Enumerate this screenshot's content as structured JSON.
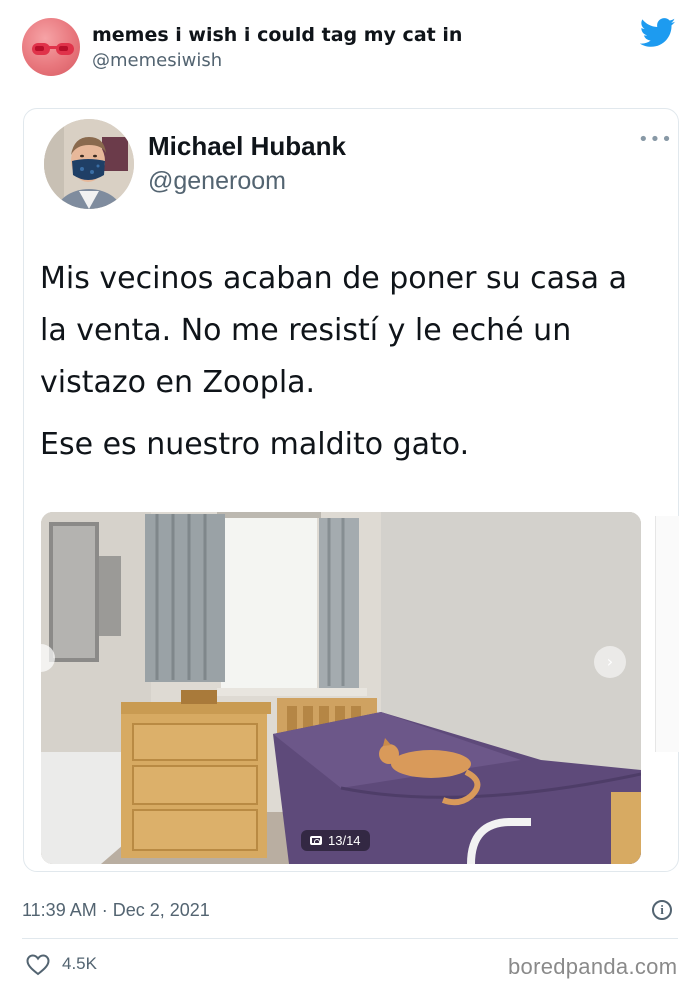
{
  "outer_tweet": {
    "name": "memes i wish i could tag my cat in",
    "handle": "@memesiwish"
  },
  "quoted_tweet": {
    "name": "Michael Hubank",
    "handle": "@generoom",
    "paragraphs": [
      "Mis vecinos acaban de poner su casa a la venta. No me resistí y le eché un vistazo en Zoopla.",
      "Ese es nuestro maldito gato."
    ],
    "photo_counter": "13/14"
  },
  "footer": {
    "timestamp": "11:39 AM · Dec 2, 2021",
    "likes": "4.5K"
  },
  "watermark": "boredpanda.com",
  "colors": {
    "twitter_blue": "#1d9bf0",
    "secondary_text": "#536471",
    "bedspread": "#5e4a7a"
  },
  "icons": [
    "twitter-bird-icon",
    "more-dots-icon",
    "next-arrow-icon",
    "camera-icon",
    "info-icon",
    "heart-icon"
  ]
}
